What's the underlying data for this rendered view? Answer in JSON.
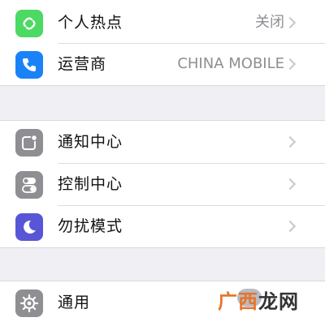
{
  "colors": {
    "hotspot_icon_bg": "#4cd964",
    "carrier_icon_bg": "#1a82f7",
    "notification_icon_bg": "#8e8e93",
    "control_icon_bg": "#8e8e93",
    "dnd_icon_bg": "#5856d6",
    "general_icon_bg": "#8e8e93",
    "watermark_orange": "#e8742a"
  },
  "settings": {
    "hotspot": {
      "label": "个人热点",
      "value": "关闭",
      "icon": "link-icon"
    },
    "carrier": {
      "label": "运营商",
      "value": "CHINA MOBILE",
      "icon": "phone-icon"
    },
    "notifications": {
      "label": "通知中心",
      "icon": "notification-center-icon"
    },
    "control_center": {
      "label": "控制中心",
      "icon": "toggle-switches-icon"
    },
    "do_not_disturb": {
      "label": "勿扰模式",
      "icon": "moon-icon"
    },
    "general": {
      "label": "通用",
      "icon": "gear-icon"
    }
  },
  "watermark": {
    "part1": "广西",
    "part2": "龙网"
  }
}
